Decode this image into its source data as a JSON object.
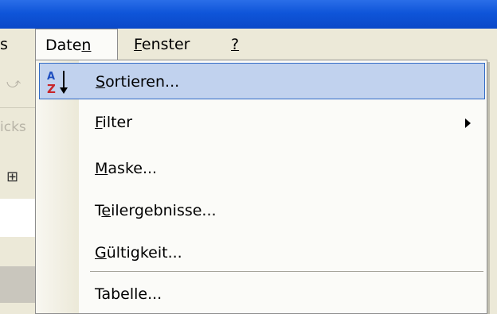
{
  "menubar": {
    "partial_left": "s",
    "daten_label": "Daten",
    "fenster_label": "Fenster",
    "help_label": "?"
  },
  "background": {
    "faint_label": "icks"
  },
  "dropdown": {
    "items": [
      {
        "label": "Sortieren...",
        "accel_index": 0,
        "icon": "sort-az-icon",
        "highlighted": true
      },
      {
        "label": "Filter",
        "accel_index": 0,
        "submenu": true
      },
      {
        "label": "Maske...",
        "accel_index": 0
      },
      {
        "label": "Teilergebnisse...",
        "accel_index": 1
      },
      {
        "label": "Gültigkeit...",
        "accel_index": 0
      },
      {
        "label": "Tabelle...",
        "accel_index": null
      }
    ]
  },
  "colors": {
    "titlebar": "#0a48c8",
    "menu_bg": "#ece9d8",
    "highlight": "#c1d2ee",
    "highlight_border": "#316ac5"
  }
}
